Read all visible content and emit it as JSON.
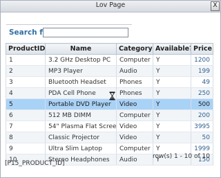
{
  "window": {
    "title": "Lov Page",
    "close_label": "X"
  },
  "search": {
    "label": "Search for",
    "value": ""
  },
  "table": {
    "columns": [
      "ProductID",
      "Name",
      "Category",
      "Available?",
      "Price"
    ],
    "rows": [
      [
        "1",
        "3.2 GHz Desktop PC",
        "Computer",
        "Y",
        "1200"
      ],
      [
        "2",
        "MP3 Player",
        "Audio",
        "Y",
        "199"
      ],
      [
        "3",
        "Bluetooth Headset",
        "Phones",
        "Y",
        "49"
      ],
      [
        "4",
        "PDA Cell Phone",
        "Phones",
        "Y",
        "250"
      ],
      [
        "5",
        "Portable DVD Player",
        "Video",
        "Y",
        "500"
      ],
      [
        "6",
        "512 MB DIMM",
        "Computer",
        "Y",
        "200"
      ],
      [
        "7",
        "54\" Plasma Flat Screen",
        "Video",
        "Y",
        "3995"
      ],
      [
        "8",
        "Classic Projector",
        "Video",
        "Y",
        "50"
      ],
      [
        "9",
        "Ultra Slim Laptop",
        "Computer",
        "Y",
        "1999"
      ],
      [
        "10",
        "Stereo Headphones",
        "Audio",
        "Y",
        "150"
      ]
    ],
    "selected_row": 4
  },
  "pagination": {
    "text": "row(s) 1 - 10 of 10"
  },
  "footer": {
    "item_name": "[P15_PRODUCT_ID]"
  },
  "colors": {
    "accent": "#2f6fa5",
    "selected_row": "#a9d2f7",
    "header_bg": "#dde3ea"
  }
}
